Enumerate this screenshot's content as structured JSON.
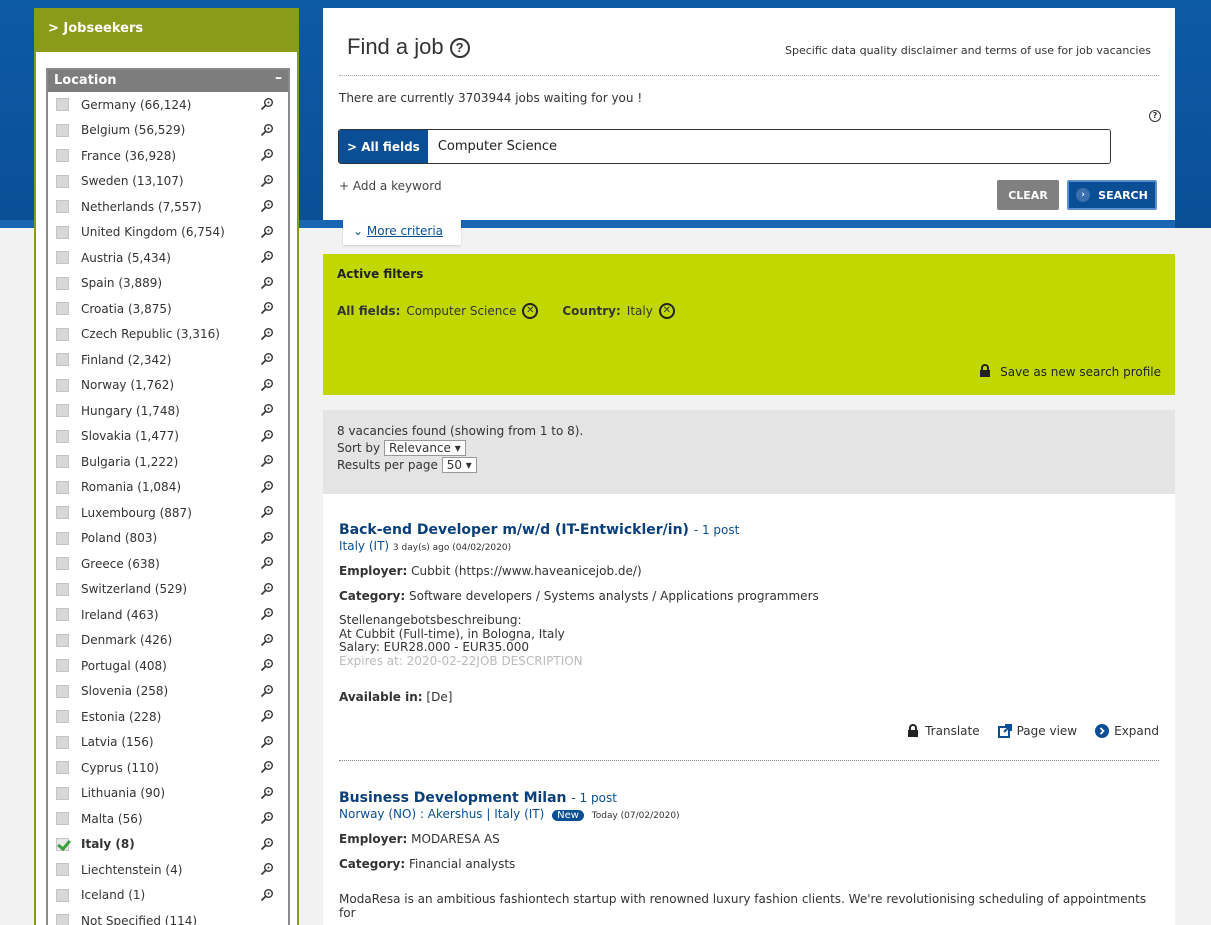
{
  "sidebar": {
    "header": "> Jobseekers",
    "location_title": "Location",
    "collapse_symbol": "–",
    "locations": [
      {
        "label": "Germany (66,124)",
        "checked": false
      },
      {
        "label": "Belgium (56,529)",
        "checked": false
      },
      {
        "label": "France (36,928)",
        "checked": false
      },
      {
        "label": "Sweden (13,107)",
        "checked": false
      },
      {
        "label": "Netherlands (7,557)",
        "checked": false
      },
      {
        "label": "United Kingdom (6,754)",
        "checked": false
      },
      {
        "label": "Austria (5,434)",
        "checked": false
      },
      {
        "label": "Spain (3,889)",
        "checked": false
      },
      {
        "label": "Croatia (3,875)",
        "checked": false
      },
      {
        "label": "Czech Republic (3,316)",
        "checked": false
      },
      {
        "label": "Finland (2,342)",
        "checked": false
      },
      {
        "label": "Norway (1,762)",
        "checked": false
      },
      {
        "label": "Hungary (1,748)",
        "checked": false
      },
      {
        "label": "Slovakia (1,477)",
        "checked": false
      },
      {
        "label": "Bulgaria (1,222)",
        "checked": false
      },
      {
        "label": "Romania (1,084)",
        "checked": false
      },
      {
        "label": "Luxembourg (887)",
        "checked": false
      },
      {
        "label": "Poland (803)",
        "checked": false
      },
      {
        "label": "Greece (638)",
        "checked": false
      },
      {
        "label": "Switzerland (529)",
        "checked": false
      },
      {
        "label": "Ireland (463)",
        "checked": false
      },
      {
        "label": "Denmark (426)",
        "checked": false
      },
      {
        "label": "Portugal (408)",
        "checked": false
      },
      {
        "label": "Slovenia (258)",
        "checked": false
      },
      {
        "label": "Estonia (228)",
        "checked": false
      },
      {
        "label": "Latvia (156)",
        "checked": false
      },
      {
        "label": "Cyprus (110)",
        "checked": false
      },
      {
        "label": "Lithuania (90)",
        "checked": false
      },
      {
        "label": "Malta (56)",
        "checked": false
      },
      {
        "label": "Italy (8)",
        "checked": true
      },
      {
        "label": "Liechtenstein (4)",
        "checked": false
      },
      {
        "label": "Iceland (1)",
        "checked": false
      },
      {
        "label": "Not Specified (114)",
        "checked": false
      }
    ]
  },
  "search": {
    "title": "Find a job",
    "disclaimer": "Specific data quality disclaimer and terms of use for job vacancies",
    "jobs_count_text": "There are currently 3703944 jobs waiting for you !",
    "field_tag": "> All fields",
    "query_value": "Computer Science",
    "add_keyword": "+ Add a keyword",
    "clear_label": "CLEAR",
    "search_label": "SEARCH",
    "more_criteria": "More criteria"
  },
  "filters": {
    "title": "Active filters",
    "items": [
      {
        "key": "All fields:",
        "value": "Computer Science"
      },
      {
        "key": "Country:",
        "value": "Italy"
      }
    ],
    "save_profile": "Save as new search profile"
  },
  "results_header": {
    "summary": "8 vacancies found (showing from 1 to 8).",
    "sort_label": "Sort by",
    "sort_value": "Relevance",
    "per_page_label": "Results per page",
    "per_page_value": "50"
  },
  "jobs": [
    {
      "title": "Back-end Developer m/w/d (IT-Entwickler/in)",
      "posts": "- 1 post",
      "location": "Italy (IT)",
      "date": "3 day(s) ago (04/02/2020)",
      "employer_label": "Employer:",
      "employer": "Cubbit (https://www.haveanicejob.de/)",
      "category_label": "Category:",
      "category": "Software developers / Systems analysts / Applications programmers",
      "desc_lines": [
        "Stellenangebotsbeschreibung:",
        "At Cubbit (Full-time), in Bologna, Italy",
        "Salary: EUR28.000 - EUR35.000",
        "Expires at: 2020-02-22JOB DESCRIPTION"
      ],
      "available_label": "Available in:",
      "available": "[De]",
      "actions": {
        "translate": "Translate",
        "page_view": "Page view",
        "expand": "Expand"
      }
    },
    {
      "title": "Business Development Milan",
      "posts": "- 1 post",
      "location": "Norway (NO) : Akershus | Italy (IT)",
      "badge": "New",
      "date": "Today (07/02/2020)",
      "employer_label": "Employer:",
      "employer": "MODARESA AS",
      "category_label": "Category:",
      "category": "Financial analysts",
      "desc_lines": [
        "ModaResa is an ambitious fashiontech startup with renowned luxury fashion clients. We're revolutionising scheduling of appointments for"
      ]
    }
  ],
  "colors": {
    "brand_blue": "#0a4f96",
    "sidebar_olive": "#8a9a1a",
    "filter_green": "#c0d800"
  }
}
